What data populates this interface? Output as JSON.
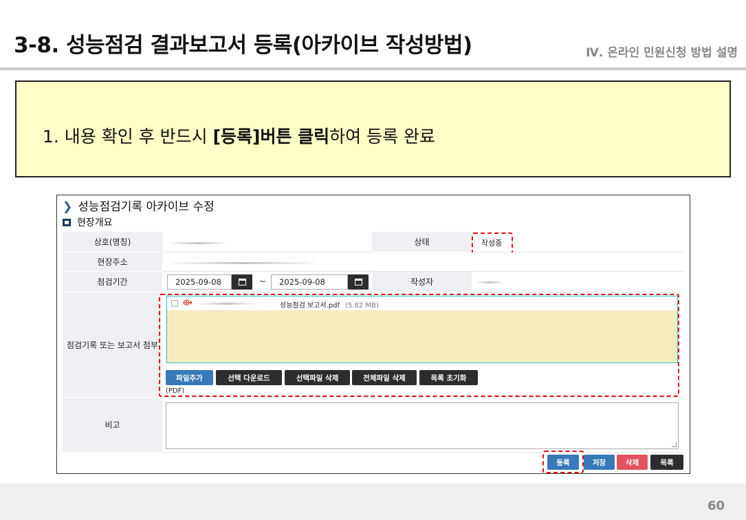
{
  "slide": {
    "title": "3-8. 성능점검 결과보고서 등록(아카이브 작성방법)",
    "section": "Ⅳ. 온라인 민원신청 방법 설명",
    "notice_prefix": "1. 내용 확인 후 반드시 ",
    "notice_bold": "[등록]버튼 클릭",
    "notice_suffix": "하여 등록 완료",
    "page_number": "60"
  },
  "screen": {
    "header": "성능점검기록 아카이브 수정",
    "section_label": "현장개요",
    "fields": {
      "company_label": "상호(명칭)",
      "status_label": "상태",
      "status_value": "작성중",
      "address_label": "현장주소",
      "period_label": "점검기간",
      "start_date": "2025-09-08",
      "period_separator": "~",
      "end_date": "2025-09-08",
      "author_label": "작성자",
      "attach_label": "점검기록 또는 보고서 첨부",
      "memo_label": "비고"
    },
    "file": {
      "name": "성능점검 보고서.pdf",
      "size": "(5.82 MB)"
    },
    "file_buttons": {
      "add": "파일추가",
      "download": "선택 다운로드",
      "delete_selected": "선택파일 삭제",
      "delete_all": "전체파일 삭제",
      "reset": "목록 초기화"
    },
    "file_note": "(PDF)",
    "actions": {
      "register": "등록",
      "save": "저장",
      "delete": "삭제",
      "list": "목록"
    }
  },
  "colors": {
    "notice_bg": "#ffffc8",
    "highlight": "#e01010",
    "primary_button": "#3879b9",
    "danger_button": "#e2535f",
    "dark_button": "#2d2d2d"
  }
}
